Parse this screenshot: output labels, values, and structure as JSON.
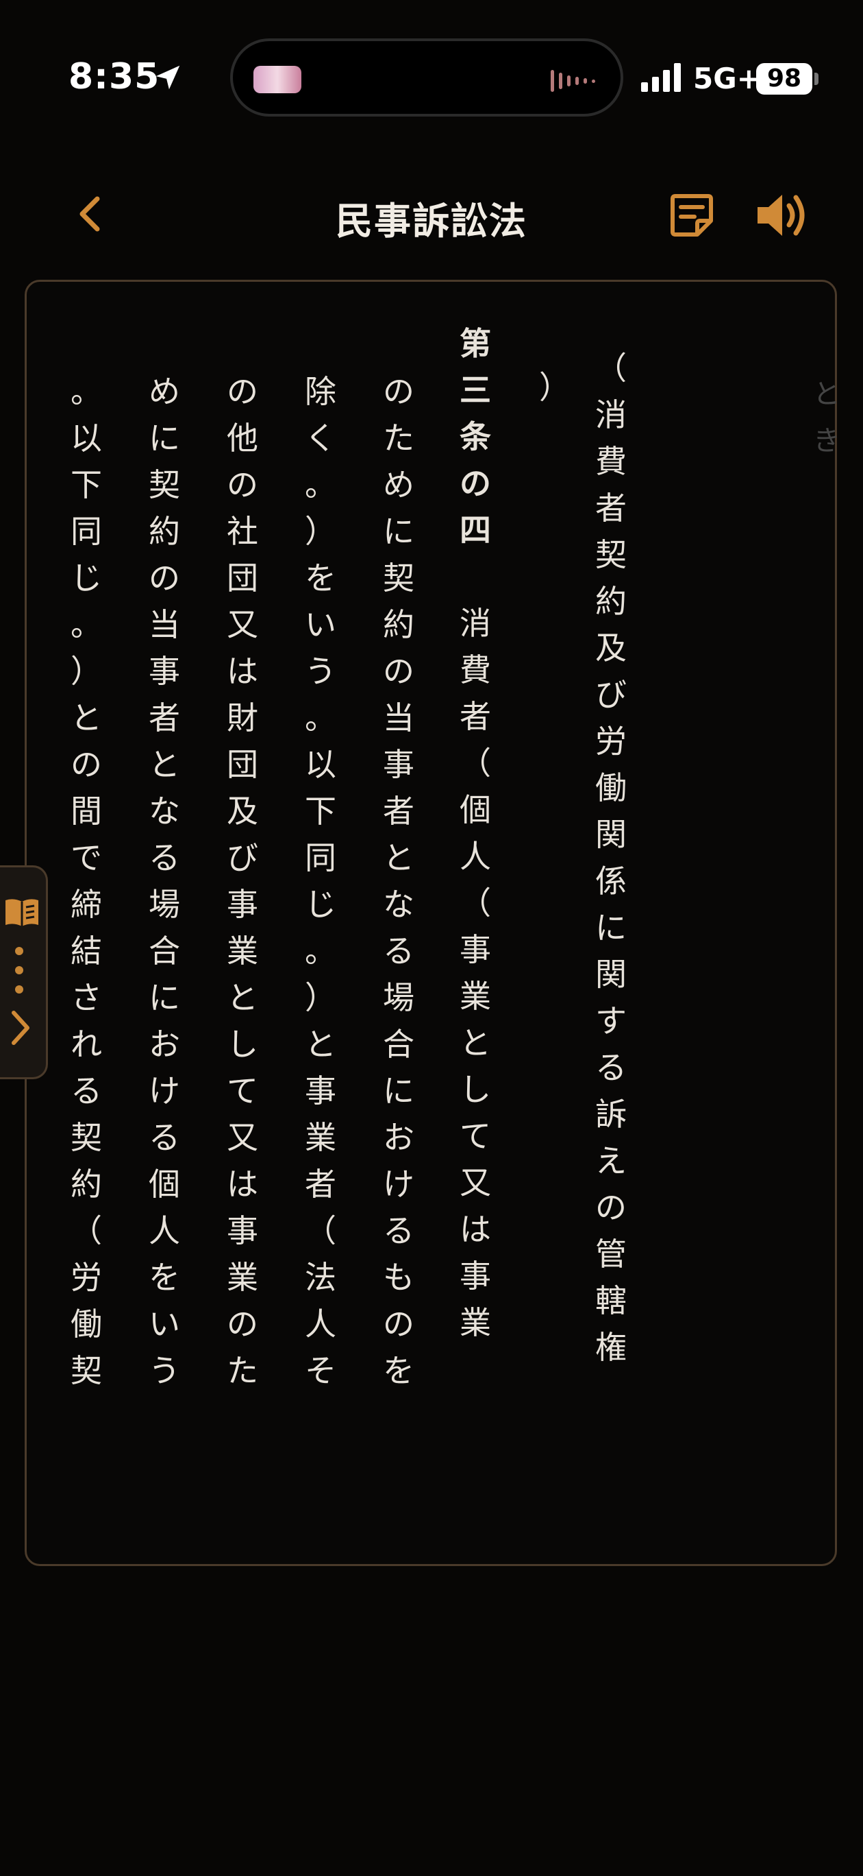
{
  "status_bar": {
    "time": "8:35",
    "network": "5G+",
    "battery": "98"
  },
  "header": {
    "title": "民事訴訟法"
  },
  "icons": {
    "back": "chevron-left-icon",
    "notes": "sticky-note-icon",
    "speaker": "speaker-icon",
    "book": "book-icon",
    "next": "chevron-right-icon",
    "location": "location-arrow-icon"
  },
  "colors": {
    "accent": "#d08a37",
    "background": "#070605",
    "text": "#e8e3db",
    "border": "#4a3a2a"
  },
  "page": {
    "prev_peek": "とき",
    "columns": [
      "（消費者契約及び労働関係に関する訴えの管轄権",
      "）",
      "第三条の四　消費者（個人（事業として又は事業",
      "のために契約の当事者となる場合におけるものを",
      "除く。）をいう。以下同じ。）と事業者（法人そ",
      "の他の社団又は財団及び事業として又は事業のた",
      "めに契約の当事者となる場合における個人をいう",
      "。以下同じ。）との間で締結される契約（労働契"
    ]
  }
}
